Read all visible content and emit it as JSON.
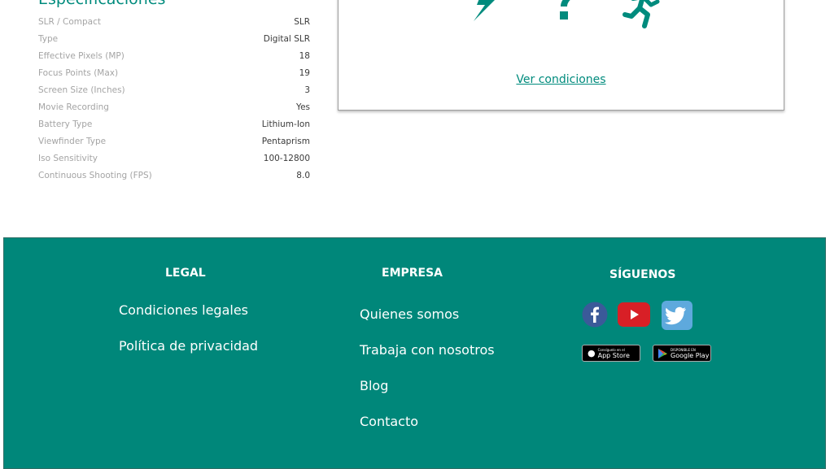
{
  "specs": {
    "title": "Especificaciones",
    "rows": [
      {
        "label": "SLR / Compact",
        "value": "SLR"
      },
      {
        "label": "Type",
        "value": "Digital SLR"
      },
      {
        "label": "Effective Pixels (MP)",
        "value": "18"
      },
      {
        "label": "Focus Points (Max)",
        "value": "19"
      },
      {
        "label": "Screen Size (Inches)",
        "value": "3"
      },
      {
        "label": "Movie Recording",
        "value": "Yes"
      },
      {
        "label": "Battery Type",
        "value": "Lithium-Ion"
      },
      {
        "label": "Viewfinder Type",
        "value": "Pentaprism"
      },
      {
        "label": "Iso Sensitivity",
        "value": "100-12800"
      },
      {
        "label": "Continuous Shooting (FPS)",
        "value": "8.0"
      }
    ]
  },
  "promo": {
    "link": "Ver condiciones",
    "icons": [
      "lightning-icon",
      "question-icon",
      "running-person-icon"
    ],
    "accent": "#008b7d"
  },
  "footer": {
    "background": "#00877a",
    "legal": {
      "heading": "LEGAL",
      "links": [
        "Condiciones legales",
        "Política de privacidad"
      ]
    },
    "empresa": {
      "heading": "EMPRESA",
      "links": [
        "Quienes somos",
        "Trabaja con nosotros",
        "Blog",
        "Contacto"
      ]
    },
    "siguenos": {
      "heading": "SÍGUENOS",
      "social": [
        "facebook-icon",
        "youtube-icon",
        "twitter-icon"
      ],
      "app_store": {
        "small": "Consíguelo en el",
        "big": "App Store"
      },
      "google_play": {
        "small": "DISPONIBLE EN",
        "big": "Google Play"
      }
    }
  }
}
